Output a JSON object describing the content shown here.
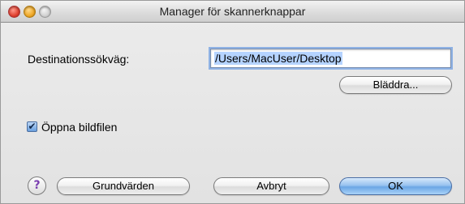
{
  "window": {
    "title": "Manager för skannerknappar"
  },
  "form": {
    "destination_label": "Destinationssökväg:",
    "destination_value": "/Users/MacUser/Desktop",
    "browse_label": "Bläddra...",
    "open_file_label": "Öppna bildfilen",
    "open_file_checked": true
  },
  "buttons": {
    "help_label": "?",
    "defaults_label": "Grundvärden",
    "cancel_label": "Avbryt",
    "ok_label": "OK"
  },
  "colors": {
    "accent": "#6ba6e5",
    "help_glyph": "#7a3fb0"
  }
}
